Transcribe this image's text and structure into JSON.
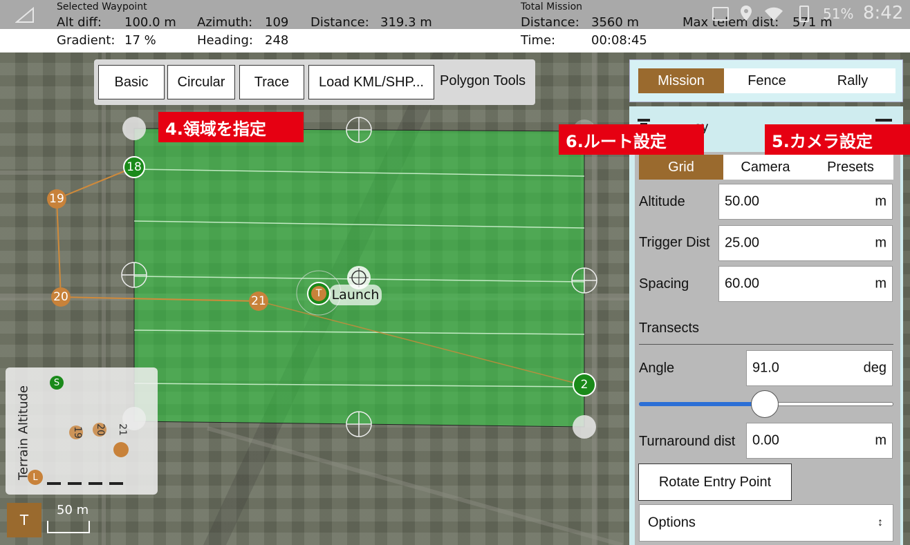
{
  "topbar": {
    "selected_waypoint_title": "Selected Waypoint",
    "alt_diff_label": "Alt diff:",
    "alt_diff_value": "100.0 m",
    "azimuth_label": "Azimuth:",
    "azimuth_value": "109",
    "distance_label": "Distance:",
    "distance_value": "319.3 m",
    "gradient_label": "Gradient:",
    "gradient_value": "17 %",
    "heading_label": "Heading:",
    "heading_value": "248",
    "total_mission_title": "Total Mission",
    "total_distance_label": "Distance:",
    "total_distance_value": "3560 m",
    "max_telem_label": "Max telem dist:",
    "max_telem_value": "571 m",
    "time_label": "Time:",
    "time_value": "00:08:45",
    "battery_text": "51%",
    "clock_text": "8:42"
  },
  "polygon_tools": {
    "title": "Polygon Tools",
    "buttons": [
      "Basic",
      "Circular",
      "Trace",
      "Load KML/SHP..."
    ]
  },
  "annotations": {
    "area": "4.領域を指定",
    "route": "6.ルート設定",
    "camera": "5.カメラ設定"
  },
  "plan_tabs": {
    "items": [
      "Mission",
      "Fence",
      "Rally"
    ],
    "active": "Mission"
  },
  "survey": {
    "title_visible": "ey",
    "tabs": [
      "Grid",
      "Camera",
      "Presets"
    ],
    "active_tab": "Grid",
    "altitude_label": "Altitude",
    "altitude_value": "50.00",
    "altitude_unit": "m",
    "trigger_label": "Trigger Dist",
    "trigger_value": "25.00",
    "trigger_unit": "m",
    "spacing_label": "Spacing",
    "spacing_value": "60.00",
    "spacing_unit": "m",
    "transects_label": "Transects",
    "angle_label": "Angle",
    "angle_value": "91.0",
    "angle_unit": "deg",
    "angle_slider_fraction": 0.5,
    "turnaround_label": "Turnaround dist",
    "turnaround_value": "0.00",
    "turnaround_unit": "m",
    "rotate_button": "Rotate Entry Point",
    "options_label": "Options"
  },
  "map": {
    "waypoints": [
      "18",
      "19",
      "20",
      "21",
      "2"
    ],
    "launch_label": "Launch",
    "launch_badge": "T",
    "scale_label": "50 m",
    "terrain_button": "T",
    "colors": {
      "survey_area": "#2ecc40",
      "waypoint_green": "#1a8a1a",
      "waypoint_orange": "#c8823a",
      "accent_brown": "#9a6a2e",
      "annotation_red": "#e60012"
    }
  },
  "terrain": {
    "label": "Terrain Altitude",
    "start_marker": "S",
    "land_marker": "L",
    "points": [
      "19",
      "20",
      "21"
    ]
  }
}
